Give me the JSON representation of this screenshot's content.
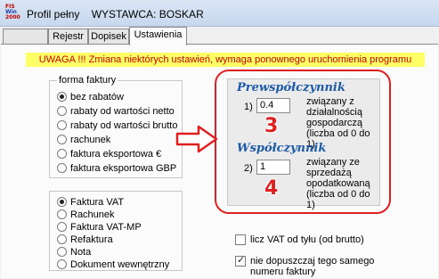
{
  "window": {
    "logo": [
      "FIS",
      "Win",
      "2000"
    ],
    "title": "Profil pełny",
    "vendor": "WYSTAWCA:  BOSKAR"
  },
  "tabs": [
    {
      "label": ""
    },
    {
      "label": "Rejestr"
    },
    {
      "label": "Dopisek"
    },
    {
      "label": "Ustawienia",
      "active": true
    }
  ],
  "warning": "UWAGA !!!  Zmiana niektórych ustawień, wymaga ponownego uruchomienia programu",
  "invoice_form": {
    "legend": "forma faktury",
    "selected": "bez rabatów",
    "options": [
      "bez rabatów",
      "rabaty od wartości netto",
      "rabaty od wartości brutto",
      "rachunek",
      "faktura eksportowa €",
      "faktura eksportowa GBP"
    ]
  },
  "document_type": {
    "selected": "Faktura VAT",
    "options": [
      "Faktura VAT",
      "Rachunek",
      "Faktura VAT-MP",
      "Refaktura",
      "Nota",
      "Dokument wewnętrzny"
    ]
  },
  "coefficients": {
    "pre": {
      "title": "Prewspółczynnik",
      "number": "1)",
      "value": "0.4",
      "desc": [
        "związany z",
        "działalnością",
        "gospodarczą",
        "(liczba od 0 do 1)"
      ],
      "badge": "3"
    },
    "coef": {
      "title": "Współczynnik",
      "number": "2)",
      "value": "1",
      "desc": [
        "związany ze",
        "sprzedażą",
        "opodatkowaną",
        "(liczba od 0 do 1)"
      ],
      "badge": "4"
    }
  },
  "options": {
    "vat_from_back": {
      "label": "licz VAT od tyłu  (od brutto)",
      "checked": false
    },
    "no_duplicate": {
      "label": [
        "nie dopuszczaj tego samego",
        "numeru faktury"
      ],
      "checked": true
    }
  },
  "colors": {
    "accent_red": "#e02020",
    "title_blue": "#1d5aa8",
    "warning_bg": "#ffff66"
  }
}
